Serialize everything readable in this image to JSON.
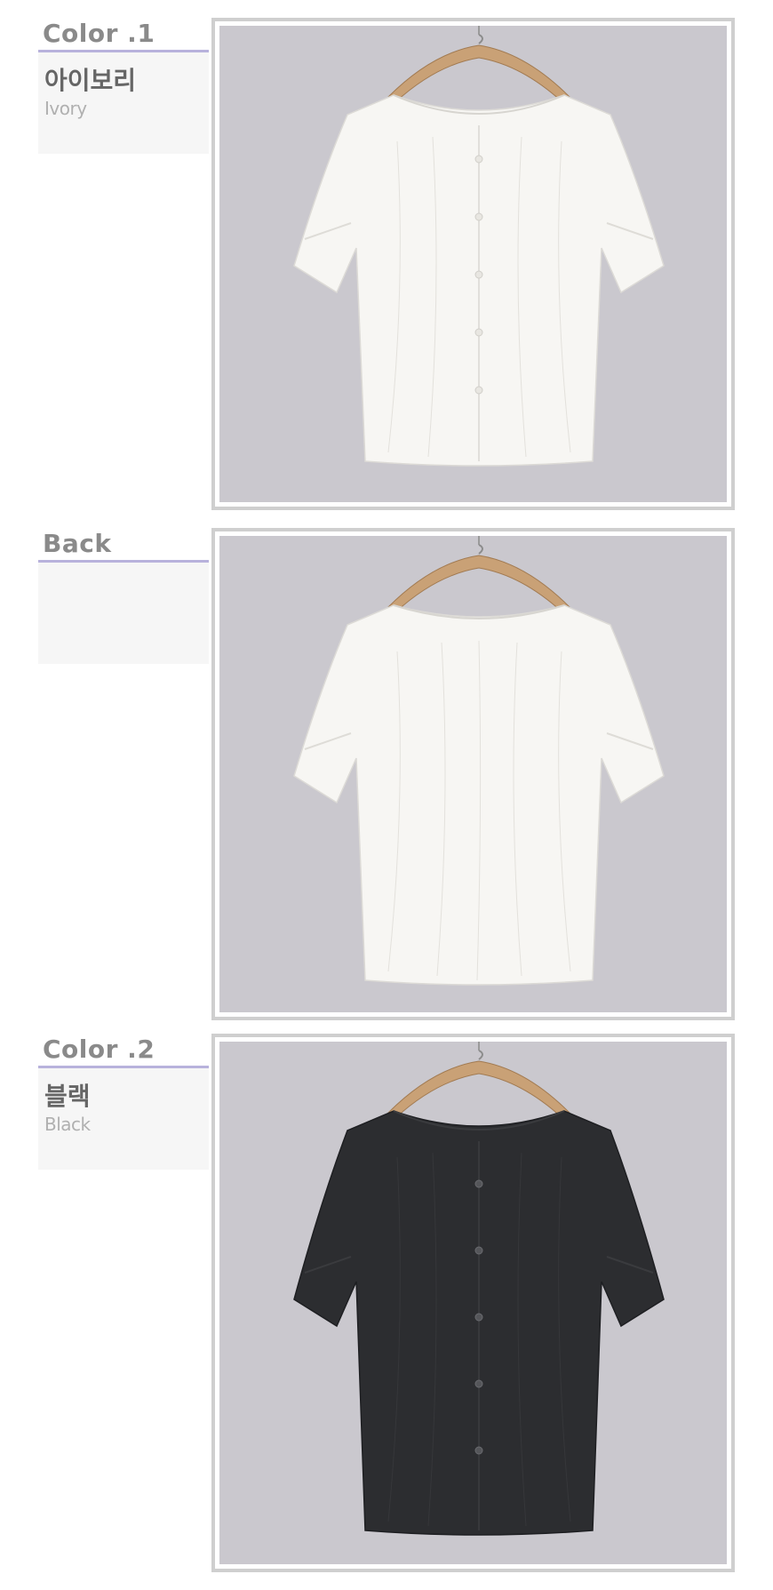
{
  "sections": [
    {
      "title": "Color .1",
      "name_ko": "아이보리",
      "name_en": "Ivory",
      "garment_color": "#f7f6f3",
      "view": "front"
    },
    {
      "title": "Back",
      "name_ko": "",
      "name_en": "",
      "garment_color": "#f7f6f3",
      "view": "back"
    },
    {
      "title": "Color .2",
      "name_ko": "블랙",
      "name_en": "Black",
      "garment_color": "#2c2d30",
      "view": "front"
    }
  ],
  "colors": {
    "accent_rule": "#b8b2dc",
    "photo_background": "#cac8ce",
    "frame_border": "#cfcfcf"
  },
  "icons": [
    "wooden-hanger-icon",
    "blouse-photo"
  ]
}
